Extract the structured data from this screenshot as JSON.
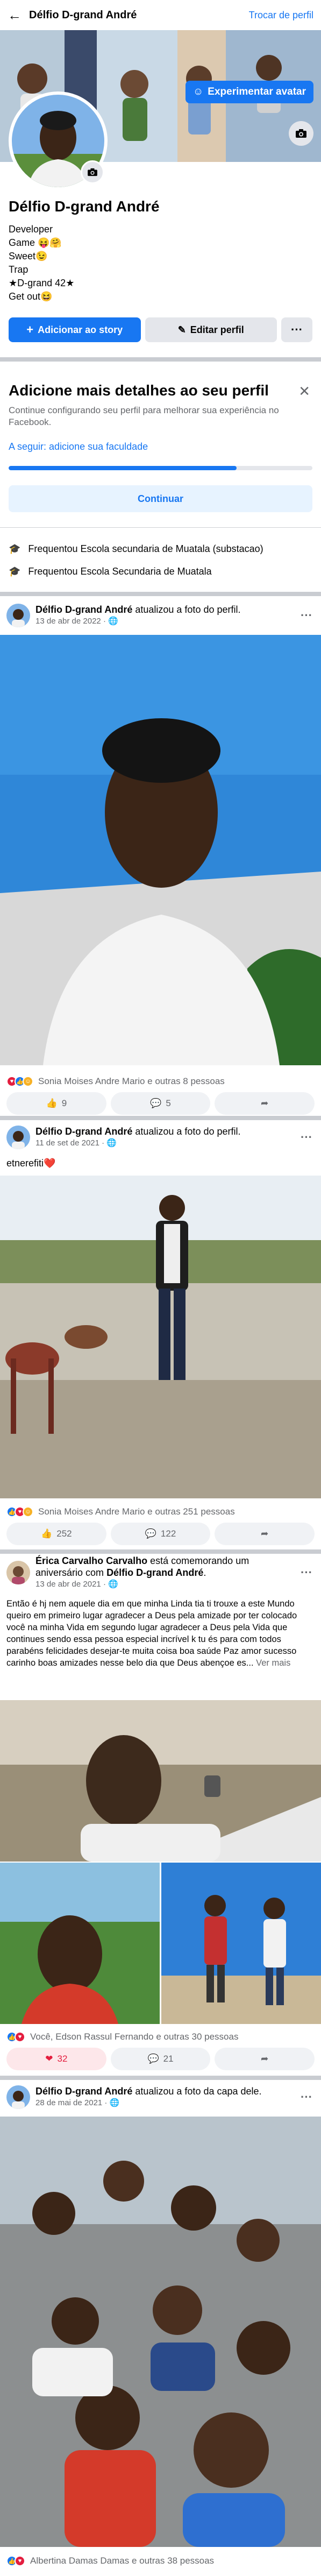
{
  "topbar": {
    "profile_name": "Délfio D-grand André",
    "switch_profile": "Trocar de perfil"
  },
  "cover": {
    "experiment_button": "Experimentar avatar"
  },
  "profile": {
    "name": "Délfio D-grand André",
    "bio": [
      "Developer",
      "Game 😝🤗",
      "Sweet😉",
      "Trap",
      "★D-grand 42★",
      "Get out😆"
    ],
    "add_story": "Adicionar ao story",
    "edit_profile": "Editar perfil"
  },
  "details": {
    "title": "Adicione mais detalhes ao seu perfil",
    "subtitle": "Continue configurando seu perfil para melhorar sua experiência no Facebook.",
    "next_step": "A seguir: adicione sua faculdade",
    "progress_fraction": 0.75,
    "continue": "Continuar"
  },
  "education": [
    "Frequentou Escola secundaria de Muatala (substacao)",
    "Frequentou Escola Secundaria de Muatala"
  ],
  "posts": [
    {
      "author": "Délfio D-grand André",
      "action": "atualizou a foto do perfil.",
      "date": "13 de abr de 2022",
      "reactions_text": "Sonia Moises Andre Mario e outras 8 pessoas",
      "likes": "9",
      "comments": "5",
      "liked": false
    },
    {
      "author": "Délfio D-grand André",
      "action": "atualizou a foto do perfil.",
      "date": "11 de set de 2021",
      "caption": "etnerefiti❤️",
      "reactions_text": "Sonia Moises Andre Mario e outras 251 pessoas",
      "likes": "252",
      "comments": "122",
      "liked": false
    },
    {
      "author": "Érica Carvalho Carvalho",
      "action_pre": "está comemorando um aniversário com",
      "action_target": "Délfio D-grand André",
      "date": "13 de abr de 2021",
      "caption": "Então é hj nem aquele dia em que minha Linda tia ti trouxe a este Mundo queiro em primeiro lugar agradecer a Deus pela amizade por ter colocado você na minha Vida em segundo lugar agradecer a Deus pela Vida que continues sendo essa pessoa especial incrível k tu és para com todos parabéns felicidades desejar-te muita coisa boa saúde Paz amor sucesso carinho boas amizades nesse belo dia que Deus abençoe es...",
      "see_more": "Ver mais",
      "reactions_text": "Você, Edson Rassul Fernando e outras 30 pessoas",
      "likes": "32",
      "comments": "21",
      "liked": true
    },
    {
      "author": "Délfio D-grand André",
      "action": "atualizou a foto da capa dele.",
      "date": "28 de mai de 2021",
      "reactions_text": "Albertina Damas Damas e outras 38 pessoas"
    }
  ],
  "colors": {
    "accent": "#1877f2",
    "like": "#1877f2",
    "love": "#e41e3f",
    "haha": "#f7b125"
  }
}
